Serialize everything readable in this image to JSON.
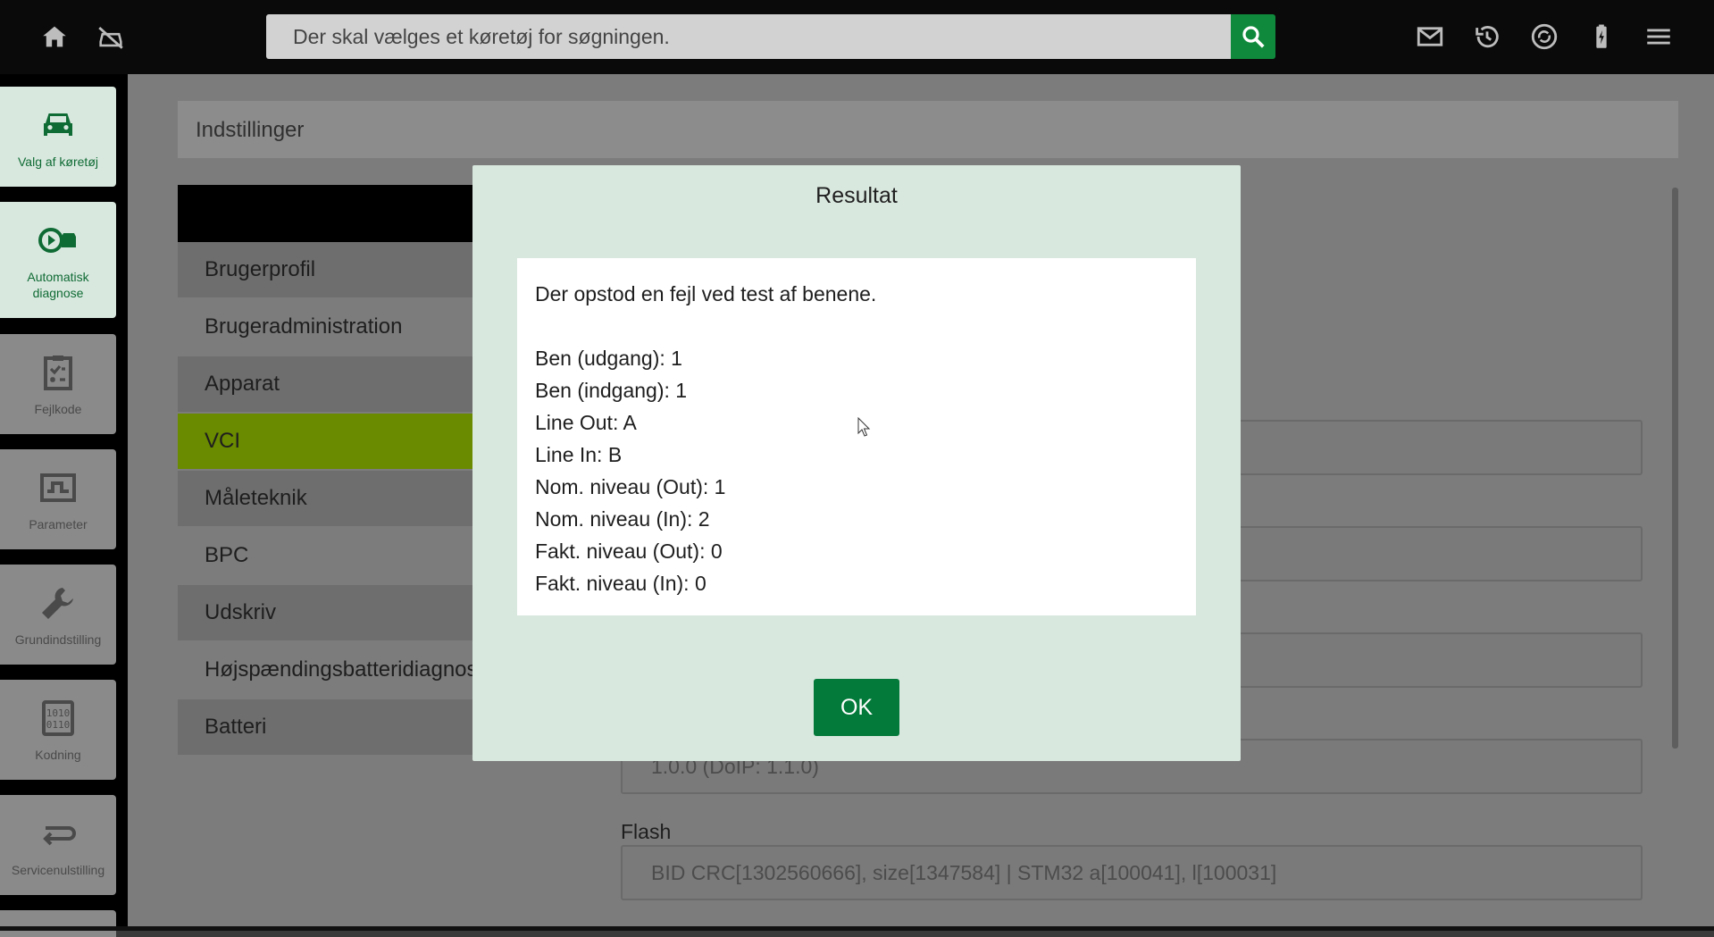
{
  "search": {
    "placeholder": "Der skal vælges et køretøj for søgningen."
  },
  "topbar": {
    "left_icons": [
      "home-icon",
      "no-vehicle-icon"
    ],
    "right_icons": [
      "mail-icon",
      "history-icon",
      "sync-icon",
      "battery-icon",
      "menu-icon"
    ]
  },
  "sidebar": {
    "items": [
      {
        "label": "Valg af køretøj",
        "icon": "car-icon"
      },
      {
        "label": "Automatisk diagnose",
        "icon": "auto-diagnosis-icon"
      },
      {
        "label": "Fejlkode",
        "icon": "fault-code-icon"
      },
      {
        "label": "Parameter",
        "icon": "parameter-icon"
      },
      {
        "label": "Grundindstilling",
        "icon": "wrench-icon"
      },
      {
        "label": "Kodning",
        "icon": "coding-icon"
      },
      {
        "label": "Servicenulstilling",
        "icon": "service-reset-icon"
      }
    ]
  },
  "page": {
    "title": "Indstillinger",
    "menu": [
      "Brugerprofil",
      "Brugeradministration",
      "Apparat",
      "VCI",
      "Måleteknik",
      "BPC",
      "Udskriv",
      "Højspændingsbatteridiagnose",
      "Batteri"
    ],
    "active_menu": "VCI",
    "fields": {
      "version_value": "1.0.0 (DoIP: 1.1.0)",
      "flash_label": "Flash",
      "flash_value": "BID CRC[1302560666], size[1347584] | STM32 a[100041], l[100031]"
    }
  },
  "dialog": {
    "title": "Resultat",
    "intro": "Der opstod en fejl ved test af benene.",
    "lines": [
      "Ben (udgang): 1",
      "Ben (indgang): 1",
      "Line Out: A",
      "Line In: B",
      "Nom. niveau (Out): 1",
      "Nom. niveau (In): 2",
      "Fakt. niveau (Out): 0",
      "Fakt. niveau (In): 0"
    ],
    "ok_label": "OK"
  },
  "colors": {
    "accent_green": "#047a3a",
    "active_menu": "#6a8a00",
    "modal_bg": "#d9e8df"
  }
}
